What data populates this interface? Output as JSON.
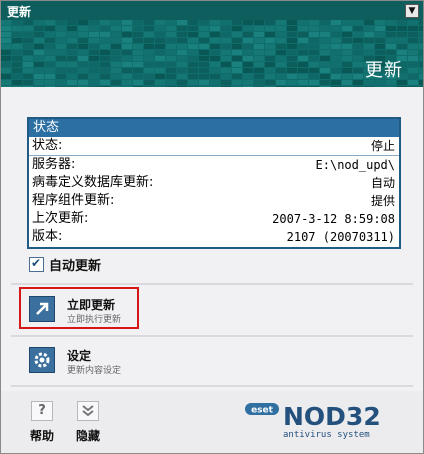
{
  "window": {
    "title": "更新",
    "control_icon": "chevron-down-icon"
  },
  "banner": {
    "title": "更新"
  },
  "status_panel": {
    "header": "状态",
    "rows": [
      {
        "label": "状态:",
        "value": "停止"
      },
      {
        "label": "服务器:",
        "value": "E:\\nod_upd\\"
      },
      {
        "label": "病毒定义数据库更新:",
        "value": "自动"
      },
      {
        "label": "程序组件更新:",
        "value": "提供"
      },
      {
        "label": "上次更新:",
        "value": "2007-3-12 8:59:08"
      },
      {
        "label": "版本:",
        "value": "2107 (20070311)"
      }
    ]
  },
  "auto_update": {
    "label": "自动更新",
    "checked": true
  },
  "commands": [
    {
      "title": "立即更新",
      "subtitle": "立即执行更新",
      "icon": "arrow-up-right-icon"
    },
    {
      "title": "设定",
      "subtitle": "更新内容设定",
      "icon": "gear-icon"
    }
  ],
  "bottom_buttons": [
    {
      "label": "帮助",
      "icon": "question-icon"
    },
    {
      "label": "隐藏",
      "icon": "double-chevron-down-icon"
    }
  ],
  "logo": {
    "brand": "eset",
    "product": "NOD32",
    "tagline": "antivirus system"
  },
  "colors": {
    "accent": "#2b6fa3",
    "title_bar": "#0d5e5c",
    "highlight": "#d41616"
  }
}
